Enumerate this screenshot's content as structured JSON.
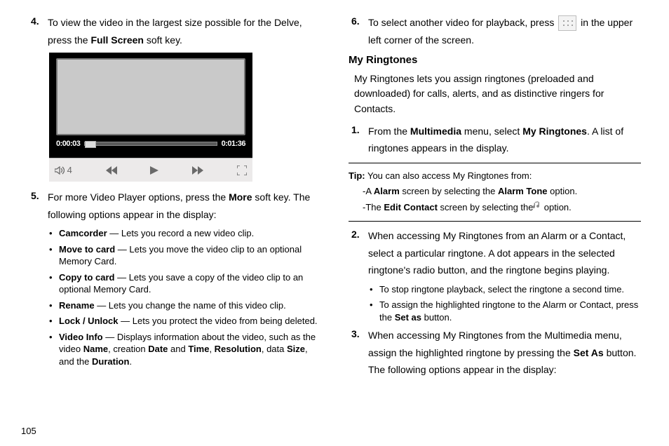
{
  "pageNumber": "105",
  "left": {
    "step4": {
      "num": "4.",
      "pre": "To view the video in the largest size possible for the Delve, press the ",
      "bold": "Full Screen",
      "post": " soft key."
    },
    "player": {
      "timeStart": "0:00:03",
      "timeEnd": "0:01:36",
      "volume": "4"
    },
    "step5": {
      "num": "5.",
      "pre": "For more Video Player options, press the ",
      "bold": "More",
      "post": " soft key. The following options appear in the display:"
    },
    "bullets": [
      {
        "bold": "Camcorder",
        "text": " — Lets you record a new video clip."
      },
      {
        "bold": "Move to card",
        "text": " — Lets you move the video clip to an optional Memory Card."
      },
      {
        "bold": "Copy to card",
        "text": " — Lets you save a copy of the video clip to an optional Memory Card."
      },
      {
        "bold": "Rename",
        "text": " — Lets you change the name of this video clip."
      },
      {
        "bold": "Lock / Unlock",
        "text": " — Lets you protect the video from being deleted."
      }
    ],
    "videoInfo": {
      "bold": "Video Info",
      "t1": " — Displays information about the video, such as the video ",
      "b1": "Name",
      "t2": ", creation ",
      "b2": "Date",
      "t3": " and ",
      "b3": "Time",
      "t4": ", ",
      "b4": "Resolution",
      "t5": ", data ",
      "b5": "Size",
      "t6": ", and the ",
      "b6": "Duration",
      "t7": "."
    }
  },
  "right": {
    "step6": {
      "num": "6.",
      "pre": "To select another video for playback, press ",
      "post": " in the upper left corner of the screen."
    },
    "heading": "My Ringtones",
    "intro": "My Ringtones lets you assign ringtones (preloaded and downloaded) for calls, alerts, and as distinctive ringers for Contacts.",
    "step1": {
      "num": "1.",
      "t1": "From the ",
      "b1": "Multimedia",
      "t2": " menu, select ",
      "b2": "My Ringtones",
      "t3": ". A list of ringtones appears in the display."
    },
    "tip": {
      "label": "Tip:",
      "text": " You can also access My Ringtones from:",
      "line1a": "-A ",
      "line1b": "Alarm",
      "line1c": " screen by selecting the ",
      "line1d": "Alarm Tone",
      "line1e": " option.",
      "line2a": "-The ",
      "line2b": "Edit Contact",
      "line2c": " screen by selecting the ",
      "line2d": " option."
    },
    "step2": {
      "num": "2.",
      "text": "When accessing My Ringtones from an Alarm or a Contact, select a particular ringtone. A dot appears in the selected ringtone's radio button, and the ringtone begins playing."
    },
    "s2bullets": {
      "a": "To stop ringtone playback, select the ringtone a second time.",
      "b_pre": "To assign the highlighted ringtone to the Alarm or Contact, press the ",
      "b_bold": "Set as",
      "b_post": " button."
    },
    "step3": {
      "num": "3.",
      "t1": "When accessing My Ringtones from the Multimedia menu, assign the highlighted ringtone by pressing the ",
      "b1": "Set As",
      "t2": " button. The following options appear in the display:"
    }
  }
}
